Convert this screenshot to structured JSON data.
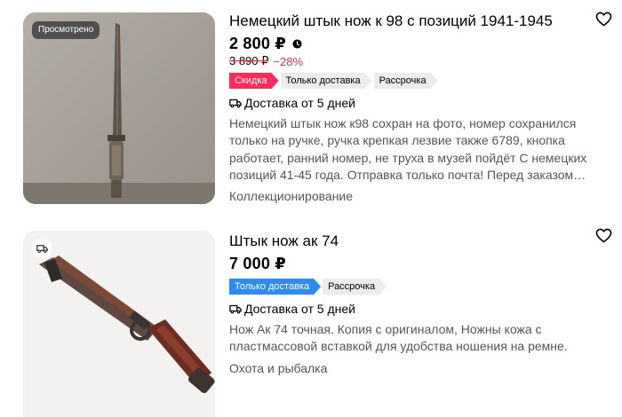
{
  "listings": [
    {
      "title": "Немецкий штык нож к 98 с позиций 1941-1945",
      "price": "2 800 ₽",
      "old_price": "3 890 ₽",
      "discount": "−28%",
      "viewed_badge": "Просмотрено",
      "tags": [
        "Скидка",
        "Только доставка",
        "Рассрочка"
      ],
      "delivery": "Доставка от 5 дней",
      "description": "Немецкий штык нож к98 сохран на фото, номер сохранился только на ручке, ручка крепкая лезвие также 6789, кнопка работает, ранний номер, не труха в музей пойдёт С немецких позиций 41-45 года. Отправка только почта! Перед заказом…",
      "category": "Коллекционирование"
    },
    {
      "title": "Штык нож ак 74",
      "price": "7 000 ₽",
      "tags": [
        "Только доставка",
        "Рассрочка"
      ],
      "delivery": "Доставка от 5 дней",
      "description": "Нож Ак 74 точная. Копия с оригиналом, Ножны кожа с пластмассовой вставкой для удобства ношения на ремне.",
      "category": "Охота и рыбалка"
    }
  ],
  "colors": {
    "discount_red": "#e52d3b",
    "tag_sale": "#ff2b58",
    "tag_delivery": "#2e8cf0",
    "tag_neutral": "#ececec"
  },
  "icons": {
    "favorite": "heart-outline-icon",
    "price_history": "clock-icon",
    "delivery": "truck-icon"
  }
}
